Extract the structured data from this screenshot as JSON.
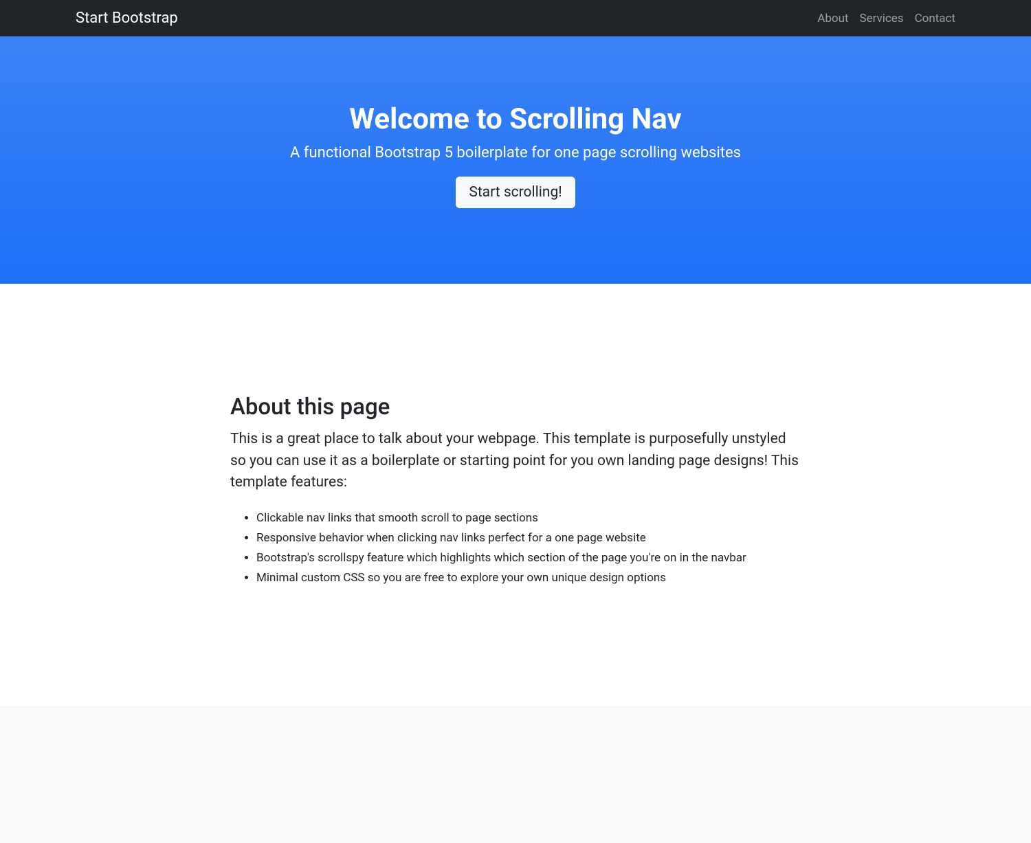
{
  "navbar": {
    "brand": "Start Bootstrap",
    "links": {
      "about": "About",
      "services": "Services",
      "contact": "Contact"
    }
  },
  "hero": {
    "title": "Welcome to Scrolling Nav",
    "subtitle": "A functional Bootstrap 5 boilerplate for one page scrolling websites",
    "cta": "Start scrolling!"
  },
  "about": {
    "heading": "About this page",
    "lead": "This is a great place to talk about your webpage. This template is purposefully unstyled so you can use it as a boilerplate or starting point for you own landing page designs! This template features:",
    "features": {
      "f1": "Clickable nav links that smooth scroll to page sections",
      "f2": "Responsive behavior when clicking nav links perfect for a one page website",
      "f3": "Bootstrap's scrollspy feature which highlights which section of the page you're on in the navbar",
      "f4": "Minimal custom CSS so you are free to explore your own unique design options"
    }
  }
}
